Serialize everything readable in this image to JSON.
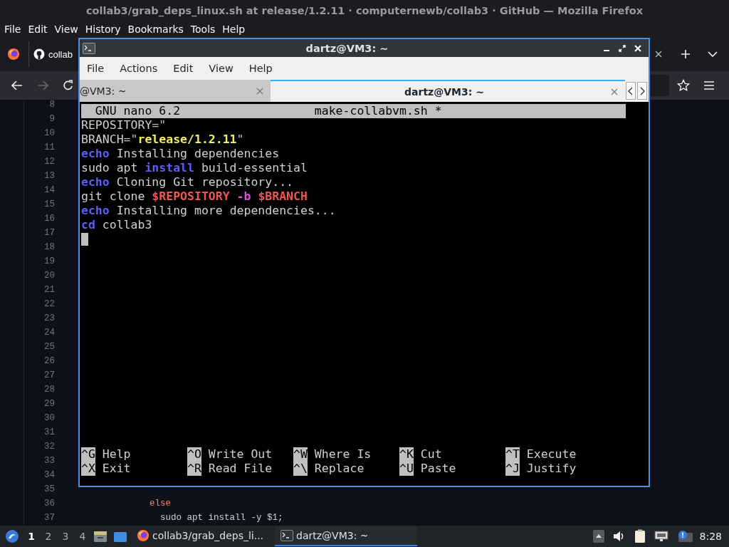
{
  "browser": {
    "title": "collab3/grab_deps_linux.sh at release/1.2.11 · computernewb/collab3 · GitHub — Mozilla Firefox",
    "menu": [
      "File",
      "Edit",
      "View",
      "History",
      "Bookmarks",
      "Tools",
      "Help"
    ],
    "tab": {
      "label": "collab"
    },
    "forward_disabled": true,
    "code_lines": [
      {
        "number": "8"
      },
      {
        "number": "9"
      },
      {
        "number": "10"
      },
      {
        "number": "11"
      },
      {
        "number": "12"
      },
      {
        "number": "13"
      },
      {
        "number": "14"
      },
      {
        "number": "15"
      },
      {
        "number": "16"
      },
      {
        "number": "17"
      },
      {
        "number": "18"
      },
      {
        "number": "19"
      },
      {
        "number": "20"
      },
      {
        "number": "21"
      },
      {
        "number": "22"
      },
      {
        "number": "23"
      },
      {
        "number": "24"
      },
      {
        "number": "25"
      },
      {
        "number": "26"
      },
      {
        "number": "27"
      },
      {
        "number": "28"
      },
      {
        "number": "29"
      },
      {
        "number": "30"
      },
      {
        "number": "31"
      },
      {
        "number": "32"
      },
      {
        "number": "33"
      },
      {
        "number": "34"
      },
      {
        "number": "35"
      },
      {
        "number": "36",
        "code": "        else",
        "kind": "keyword"
      },
      {
        "number": "37",
        "code": "          sudo apt install -y $1;",
        "kind": "plain"
      }
    ]
  },
  "terminal": {
    "title": "dartz@VM3: ~",
    "menu": [
      "File",
      "Actions",
      "Edit",
      "View",
      "Help"
    ],
    "tabs": [
      {
        "label": "@VM3: ~",
        "selected": false
      },
      {
        "label": "dartz@VM3: ~",
        "selected": true
      }
    ],
    "nano": {
      "version": "GNU nano 6.2",
      "filename": "make-collabvm.sh *",
      "lines": [
        [
          {
            "text": "REPOSITORY",
            "kind": "plain"
          },
          {
            "text": "=\"",
            "kind": "operator"
          }
        ],
        [
          {
            "text": "BRANCH",
            "kind": "plain"
          },
          {
            "text": "=\"",
            "kind": "operator"
          },
          {
            "text": "release/1.2.11",
            "kind": "string"
          },
          {
            "text": "\"",
            "kind": "operator"
          }
        ],
        [
          {
            "text": "echo",
            "kind": "keyword"
          },
          {
            "text": " Installing dependencies",
            "kind": "plain"
          }
        ],
        [
          {
            "text": "sudo apt ",
            "kind": "plain"
          },
          {
            "text": "install",
            "kind": "keyword"
          },
          {
            "text": " build-essential",
            "kind": "plain"
          }
        ],
        [
          {
            "text": "echo",
            "kind": "keyword"
          },
          {
            "text": " Cloning Git repository...",
            "kind": "plain"
          }
        ],
        [
          {
            "text": "git clone ",
            "kind": "plain"
          },
          {
            "text": "$REPOSITORY",
            "kind": "variable"
          },
          {
            "text": " -b ",
            "kind": "flag"
          },
          {
            "text": "$BRANCH",
            "kind": "variable"
          }
        ],
        [
          {
            "text": "echo",
            "kind": "keyword"
          },
          {
            "text": " Installing more dependencies...",
            "kind": "plain"
          }
        ],
        [
          {
            "text": "cd",
            "kind": "keyword"
          },
          {
            "text": " collab3",
            "kind": "plain"
          }
        ]
      ],
      "shortcuts": [
        [
          {
            "key": "^G",
            "label": "Help"
          },
          {
            "key": "^O",
            "label": "Write Out"
          },
          {
            "key": "^W",
            "label": "Where Is"
          },
          {
            "key": "^K",
            "label": "Cut"
          },
          {
            "key": "^T",
            "label": "Execute"
          }
        ],
        [
          {
            "key": "^X",
            "label": "Exit"
          },
          {
            "key": "^R",
            "label": "Read File"
          },
          {
            "key": "^\\",
            "label": "Replace"
          },
          {
            "key": "^U",
            "label": "Paste"
          },
          {
            "key": "^J",
            "label": "Justify"
          }
        ]
      ]
    }
  },
  "taskbar": {
    "workspaces": [
      {
        "label": "1",
        "selected": true
      },
      {
        "label": "2",
        "selected": false
      },
      {
        "label": "3",
        "selected": false
      },
      {
        "label": "4",
        "selected": false
      }
    ],
    "tasks": [
      {
        "label": "collab3/grab_deps_li...",
        "kind": "browser",
        "selected": false
      },
      {
        "label": "dartz@VM3: ~",
        "kind": "terminal",
        "selected": true
      }
    ],
    "clock": "8:28"
  }
}
